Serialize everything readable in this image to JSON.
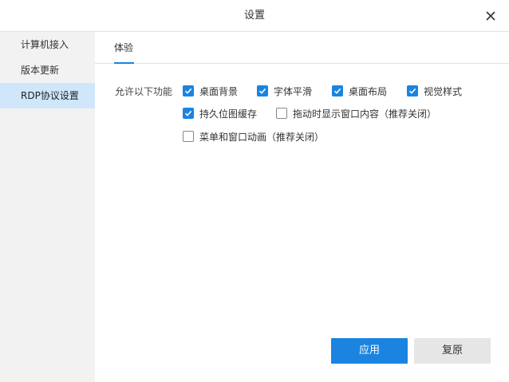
{
  "window": {
    "title": "设置"
  },
  "sidebar": {
    "items": [
      {
        "label": "计算机接入"
      },
      {
        "label": "版本更新"
      },
      {
        "label": "RDP协议设置"
      }
    ]
  },
  "tabs": [
    {
      "label": "体验"
    }
  ],
  "experience": {
    "section_label": "允许以下功能",
    "options": [
      {
        "label": "桌面背景",
        "checked": true
      },
      {
        "label": "字体平滑",
        "checked": true
      },
      {
        "label": "桌面布局",
        "checked": true
      },
      {
        "label": "视觉样式",
        "checked": true
      },
      {
        "label": "持久位图缓存",
        "checked": true
      },
      {
        "label": "拖动时显示窗口内容（推荐关闭）",
        "checked": false
      },
      {
        "label": "菜单和窗口动画（推荐关闭）",
        "checked": false
      }
    ]
  },
  "buttons": {
    "apply": "应用",
    "reset": "复原"
  },
  "colors": {
    "accent": "#1a84e0",
    "sidebar_bg": "#f2f2f2",
    "sidebar_active": "#cfe6fb"
  }
}
